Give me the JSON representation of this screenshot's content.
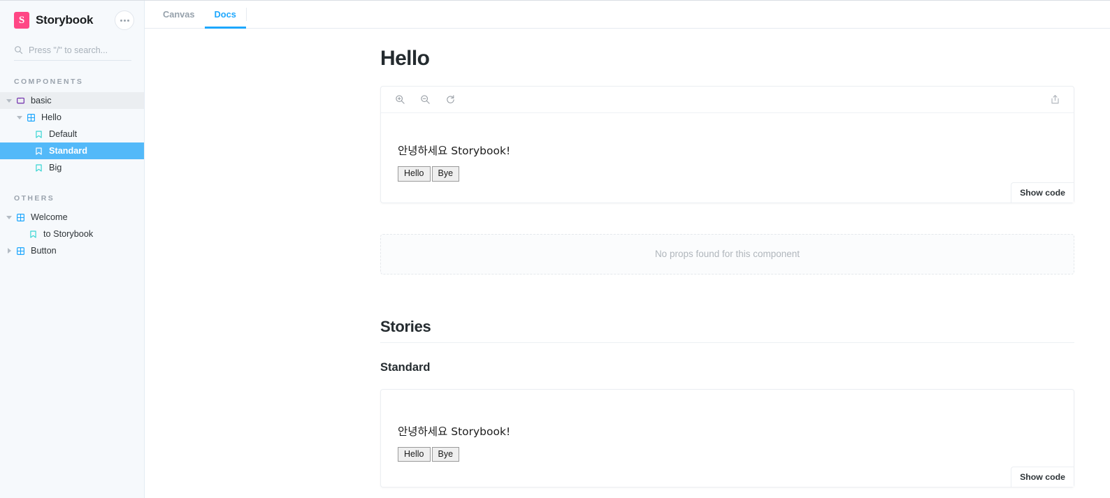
{
  "sidebar": {
    "brand": {
      "logo_letter": "S",
      "name": "Storybook",
      "menu_icon": "ellipsis-icon"
    },
    "search": {
      "placeholder": "Press \"/\" to search...",
      "value": "",
      "icon": "search-icon"
    },
    "sections": [
      {
        "header": "COMPONENTS",
        "items": [
          {
            "label": "basic",
            "depth": 0,
            "icon": "folder-icon",
            "state": "expanded",
            "selected": false,
            "hovered": true
          },
          {
            "label": "Hello",
            "depth": 1,
            "icon": "component-icon",
            "state": "expanded",
            "selected": false,
            "hovered": false
          },
          {
            "label": "Default",
            "depth": 2,
            "icon": "story-icon",
            "state": "leaf",
            "selected": false,
            "hovered": false
          },
          {
            "label": "Standard",
            "depth": 2,
            "icon": "story-icon",
            "state": "leaf",
            "selected": true,
            "hovered": false
          },
          {
            "label": "Big",
            "depth": 2,
            "icon": "story-icon",
            "state": "leaf",
            "selected": false,
            "hovered": false
          }
        ]
      },
      {
        "header": "OTHERS",
        "items": [
          {
            "label": "Welcome",
            "depth": 0,
            "icon": "component-icon",
            "state": "expanded",
            "selected": false,
            "hovered": false
          },
          {
            "label": "to Storybook",
            "depth": 1,
            "icon": "story-icon",
            "state": "leaf",
            "selected": false,
            "hovered": false
          },
          {
            "label": "Button",
            "depth": 0,
            "icon": "component-icon",
            "state": "collapsed",
            "selected": false,
            "hovered": false
          }
        ]
      }
    ]
  },
  "tabs": [
    {
      "label": "Canvas",
      "active": false
    },
    {
      "label": "Docs",
      "active": true
    }
  ],
  "docs": {
    "title": "Hello",
    "preview_toolbar": {
      "zoom_in_icon": "zoom-in-icon",
      "zoom_out_icon": "zoom-out-icon",
      "zoom_reset_icon": "zoom-reset-icon",
      "open_external_icon": "share-icon"
    },
    "primary_story": {
      "text": "안녕하세요 Storybook!",
      "buttons": [
        "Hello",
        "Bye"
      ],
      "show_code_label": "Show code"
    },
    "props_empty_message": "No props found for this component",
    "stories_heading": "Stories",
    "stories": [
      {
        "name": "Standard",
        "text": "안녕하세요 Storybook!",
        "buttons": [
          "Hello",
          "Bye"
        ],
        "show_code_label": "Show code"
      }
    ]
  },
  "colors": {
    "brand_pink": "#ff4785",
    "accent_blue": "#1ea7fd",
    "selected_blue": "#53b9f9",
    "sidebar_bg": "#f6f9fc",
    "folder_purple": "#6f2cac",
    "component_blue": "#1ea7fd",
    "story_teal": "#37d5d3"
  }
}
